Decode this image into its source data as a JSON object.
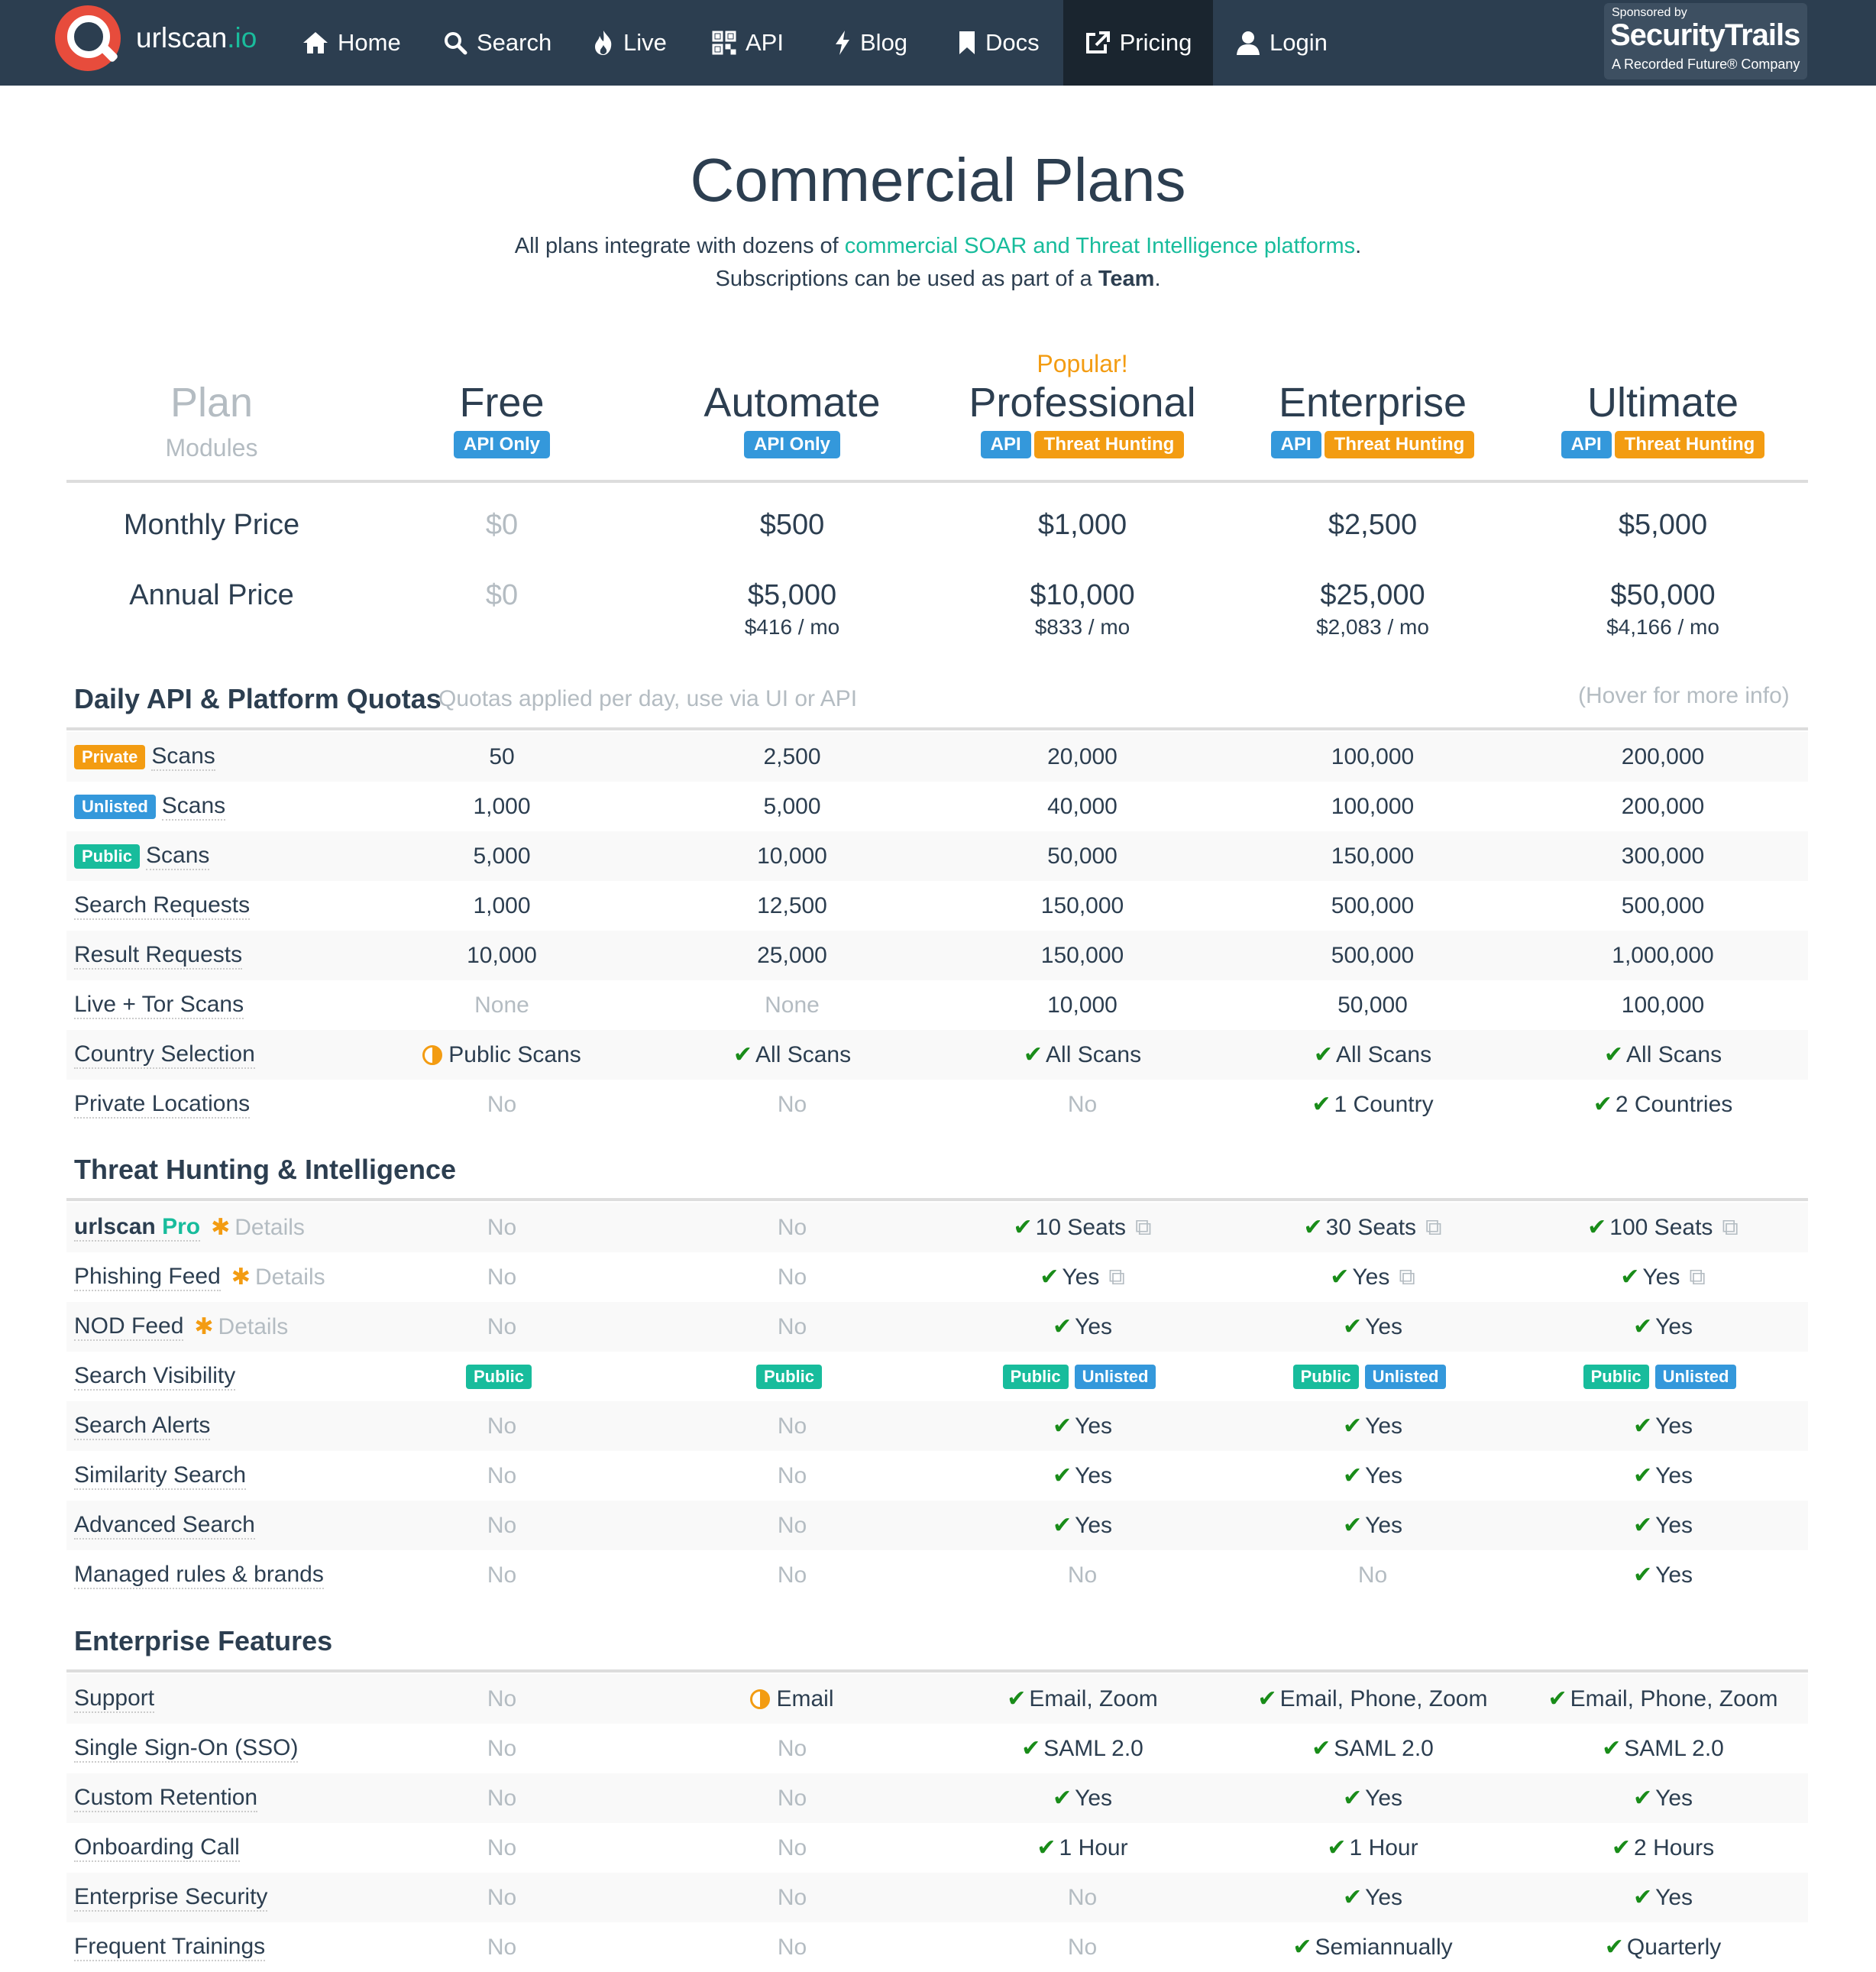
{
  "nav": {
    "logo_text": "urlscan",
    "logo_suffix": ".io",
    "items": [
      {
        "label": "Home",
        "icon": "home-icon"
      },
      {
        "label": "Search",
        "icon": "search-icon"
      },
      {
        "label": "Live",
        "icon": "flame-icon"
      },
      {
        "label": "API",
        "icon": "qrcode-icon"
      },
      {
        "label": "Blog",
        "icon": "bolt-icon"
      },
      {
        "label": "Docs",
        "icon": "bookmark-icon"
      },
      {
        "label": "Pricing",
        "icon": "external-link-icon"
      },
      {
        "label": "Login",
        "icon": "user-icon"
      }
    ],
    "sponsor": {
      "line1": "Sponsored by",
      "line2": "SecurityTrails",
      "line3": "A Recorded Future® Company"
    }
  },
  "header": {
    "title": "Commercial Plans",
    "sub1_pre": "All plans integrate with dozens of ",
    "sub1_link": "commercial SOAR and Threat Intelligence platforms",
    "sub1_post": ".",
    "sub2_pre": "Subscriptions can be used as part of a ",
    "sub2_bold": "Team",
    "sub2_post": "."
  },
  "plans": {
    "label_col": {
      "name": "Plan",
      "modules": "Modules"
    },
    "popular": "Popular!",
    "columns": [
      {
        "name": "Free",
        "badges": [
          "API Only"
        ]
      },
      {
        "name": "Automate",
        "badges": [
          "API Only"
        ]
      },
      {
        "name": "Professional",
        "badges": [
          "API",
          "Threat Hunting"
        ]
      },
      {
        "name": "Enterprise",
        "badges": [
          "API",
          "Threat Hunting"
        ]
      },
      {
        "name": "Ultimate",
        "badges": [
          "API",
          "Threat Hunting"
        ]
      }
    ]
  },
  "prices": {
    "monthly_label": "Monthly Price",
    "annual_label": "Annual Price",
    "monthly": [
      "$0",
      "$500",
      "$1,000",
      "$2,500",
      "$5,000"
    ],
    "annual": [
      "$0",
      "$5,000",
      "$10,000",
      "$25,000",
      "$50,000"
    ],
    "per_month": [
      "",
      "$416 / mo",
      "$833 / mo",
      "$2,083 / mo",
      "$4,166 / mo"
    ]
  },
  "quotas": {
    "title": "Daily API & Platform Quotas",
    "note": "Quotas applied per day, use via UI or API",
    "hover": "(Hover for more info)",
    "rows": [
      {
        "tag": "Private",
        "label": "Scans",
        "values": [
          "50",
          "2,500",
          "20,000",
          "100,000",
          "200,000"
        ]
      },
      {
        "tag": "Unlisted",
        "label": "Scans",
        "values": [
          "1,000",
          "5,000",
          "40,000",
          "100,000",
          "200,000"
        ]
      },
      {
        "tag": "Public",
        "label": "Scans",
        "values": [
          "5,000",
          "10,000",
          "50,000",
          "150,000",
          "300,000"
        ]
      },
      {
        "label": "Search Requests",
        "values": [
          "1,000",
          "12,500",
          "150,000",
          "500,000",
          "500,000"
        ]
      },
      {
        "label": "Result Requests",
        "values": [
          "10,000",
          "25,000",
          "150,000",
          "500,000",
          "1,000,000"
        ]
      },
      {
        "label": "Live + Tor Scans",
        "values": [
          "None",
          "None",
          "10,000",
          "50,000",
          "100,000"
        ]
      },
      {
        "label": "Country Selection",
        "values": [
          "Public Scans",
          "All Scans",
          "All Scans",
          "All Scans",
          "All Scans"
        ]
      },
      {
        "label": "Private Locations",
        "values": [
          "No",
          "No",
          "No",
          "1 Country",
          "2 Countries"
        ]
      }
    ]
  },
  "threat": {
    "title": "Threat Hunting & Intelligence",
    "details": "Details",
    "rows": [
      {
        "label": "urlscan",
        "label_suffix": "Pro",
        "values": [
          "No",
          "No",
          "10 Seats",
          "30 Seats",
          "100 Seats"
        ]
      },
      {
        "label": "Phishing Feed",
        "values": [
          "No",
          "No",
          "Yes",
          "Yes",
          "Yes"
        ]
      },
      {
        "label": "NOD Feed",
        "values": [
          "No",
          "No",
          "Yes",
          "Yes",
          "Yes"
        ]
      },
      {
        "label": "Search Visibility",
        "values": [
          "Public",
          "Public",
          "Public",
          "Public",
          "Public"
        ],
        "extra": [
          "",
          "",
          "Unlisted",
          "Unlisted",
          "Unlisted"
        ]
      },
      {
        "label": "Search Alerts",
        "values": [
          "No",
          "No",
          "Yes",
          "Yes",
          "Yes"
        ]
      },
      {
        "label": "Similarity Search",
        "values": [
          "No",
          "No",
          "Yes",
          "Yes",
          "Yes"
        ]
      },
      {
        "label": "Advanced Search",
        "values": [
          "No",
          "No",
          "Yes",
          "Yes",
          "Yes"
        ]
      },
      {
        "label": "Managed rules & brands",
        "values": [
          "No",
          "No",
          "No",
          "No",
          "Yes"
        ]
      }
    ]
  },
  "enterprise": {
    "title": "Enterprise Features",
    "rows": [
      {
        "label": "Support",
        "values": [
          "No",
          "Email",
          "Email, Zoom",
          "Email, Phone, Zoom",
          "Email, Phone, Zoom"
        ]
      },
      {
        "label": "Single Sign-On (SSO)",
        "values": [
          "No",
          "No",
          "SAML 2.0",
          "SAML 2.0",
          "SAML 2.0"
        ]
      },
      {
        "label": "Custom Retention",
        "values": [
          "No",
          "No",
          "Yes",
          "Yes",
          "Yes"
        ]
      },
      {
        "label": "Onboarding Call",
        "values": [
          "No",
          "No",
          "1 Hour",
          "1 Hour",
          "2 Hours"
        ]
      },
      {
        "label": "Enterprise Security",
        "values": [
          "No",
          "No",
          "No",
          "Yes",
          "Yes"
        ]
      },
      {
        "label": "Frequent Trainings",
        "values": [
          "No",
          "No",
          "No",
          "Semiannually",
          "Quarterly"
        ]
      }
    ]
  },
  "colors": {
    "navbar": "#2c3e50",
    "accent": "#18bc9c",
    "orange": "#f39c12",
    "blue": "#3498db",
    "check": "#198c19",
    "muted": "#b4bcc2"
  }
}
